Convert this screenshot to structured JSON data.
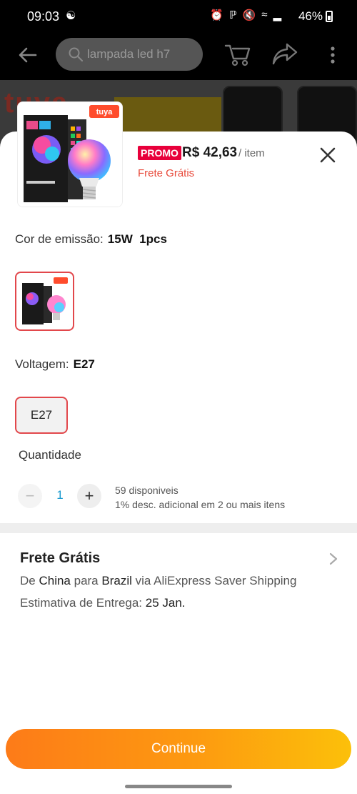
{
  "status_bar": {
    "time": "09:03",
    "battery": "46%"
  },
  "top_nav": {
    "search_text": "lampada led h7"
  },
  "product": {
    "brand": "tuya",
    "promo_badge": "PROMO",
    "price": "R$ 42,63",
    "per_item": "/ item",
    "free_shipping": "Frete Grátis"
  },
  "color": {
    "label": "Cor de emissão:",
    "value": "15W  1pcs"
  },
  "voltage": {
    "label": "Voltagem:",
    "value": "E27",
    "option": "E27"
  },
  "quantity": {
    "label": "Quantidade",
    "value": "1",
    "available": "59 disponiveis",
    "discount": "1% desc. adicional em 2 ou mais itens"
  },
  "shipping": {
    "title": "Frete Grátis",
    "from_prefix": "De ",
    "from": "China",
    "to_prefix": " para ",
    "to": "Brazil",
    "via": " via AliExpress Saver Shipping",
    "estimate_label": "Estimativa de Entrega: ",
    "estimate_date": "25 Jan."
  },
  "continue_label": "Continue",
  "colors": {
    "accent": "#e8003b",
    "selected_border": "#e2474b",
    "button_start": "#fd7b18",
    "button_end": "#fcc00a"
  }
}
